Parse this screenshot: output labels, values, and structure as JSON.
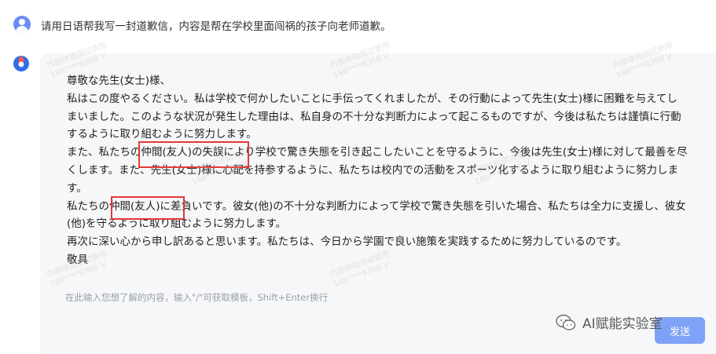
{
  "user_message": {
    "text": "请用日语帮我写一封道歉信，内容是帮在学校里面闯祸的孩子向老师道歉。"
  },
  "answer": {
    "lines": [
      "尊敬な先生(女士)様、",
      "私はこの度やるください。私は学校で何かしたいことに手伝ってくれましたが、その行動によって先生(女士)様に困難を与えてしまいました。このような状況が発生した理由は、私自身の不十分な判断力によって起こるものですが、今後は私たちは謹慎に行動するように取り組むように努力します。",
      "また、私たちの仲間(友人)の失誤により学校で驚き失態を引き起こしたいことを守るように、今後は先生(女士)様に対して最善を尽くします。また、先生(女士)様に心配を持参するように、私たちは校内での活動をスポーツ化するように取り組むように努力します。",
      "私たちの仲間(友人)に差負いです。彼女(他)の不十分な判断力によって学校で驚き失態を引いた場合、私たちは全力に支援し、彼女(他)を守るように取り組むように努力します。",
      "再次に深い心から申し訳あると思います。私たちは、今日から学園で良い施策を実践するために努力しているのです。",
      "敬具"
    ]
  },
  "input": {
    "placeholder": "在此输入您想了解的内容，输入\"/\"可获取模板，Shift+Enter换行"
  },
  "send_button": {
    "label": "发送"
  },
  "watermarks": {
    "corner_text": "AI赋能实验室",
    "repeated_line1": "内部体验测试使用",
    "repeated_line2": "186****8368 V"
  },
  "colors": {
    "highlight_border": "#e53935",
    "send_button": "#7ea2f5",
    "user_avatar": "#6f8cf3",
    "card_background": "#f6f7f9"
  }
}
